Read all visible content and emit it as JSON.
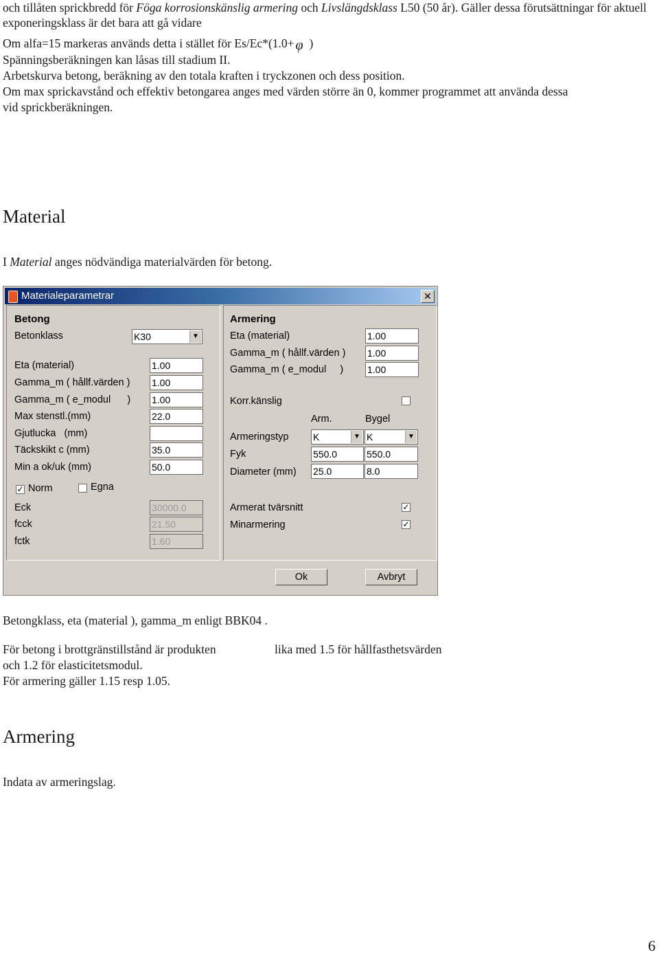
{
  "intro": {
    "line1_a": "och tillåten sprickbredd för ",
    "line1_italic1": "Föga korrosionskänslig armering",
    "line1_b": " och ",
    "line1_italic2": "Livslängdsklass",
    "line1_c": " L50 (50 år). Gäller dessa förutsättningar för aktuell",
    "line2": "exponeringsklass är det bara att gå vidare",
    "line3_a": "Om alfa=15 markeras används detta i stället för Es/Ec*(1.0+",
    "line3_phi": "φ",
    "line3_b": ")",
    "line4": "Spänningsberäkningen kan låsas till stadium II.",
    "line5": "Arbetskurva betong, beräkning av den totala kraften i tryckzonen och dess position.",
    "line6": "Om max sprickavstånd och effektiv betongarea anges med värden större än 0, kommer programmet att använda dessa",
    "line7": "vid sprickberäkningen."
  },
  "material_section": {
    "heading": "Material",
    "desc_a": "I ",
    "desc_italic": "Material",
    "desc_b": " anges nödvändiga materialvärden för betong."
  },
  "dialog": {
    "title": "Materialeparametrar",
    "close_symbol": "✕",
    "betong": {
      "group_label": "Betong",
      "betonklass_label": "Betonklass",
      "betonklass_value": "K30",
      "fields": [
        {
          "label": "Eta (material)",
          "value": "1.00"
        },
        {
          "label": "Gamma_m ( hållf.värden )",
          "value": "1.00"
        },
        {
          "label": "Gamma_m ( e_modul      )",
          "value": "1.00"
        },
        {
          "label": "Max stenstl.(mm)",
          "value": "22.0"
        },
        {
          "label": "Gjutlucka   (mm)",
          "value": ""
        },
        {
          "label": "Täckskikt c (mm)",
          "value": "35.0"
        },
        {
          "label": "Min a ok/uk (mm)",
          "value": "50.0"
        }
      ],
      "norm_label": "Norm",
      "norm_checked": true,
      "egna_label": "Egna",
      "egna_checked": false,
      "computed": [
        {
          "label": "Eck",
          "value": "30000.0"
        },
        {
          "label": "fcck",
          "value": "21.50"
        },
        {
          "label": "fctk",
          "value": "1.60"
        }
      ]
    },
    "armering": {
      "group_label": "Armering",
      "fields": [
        {
          "label": "Eta (material)",
          "value": "1.00"
        },
        {
          "label": "Gamma_m ( hållf.värden )",
          "value": "1.00"
        },
        {
          "label": "Gamma_m ( e_modul     )",
          "value": "1.00"
        }
      ],
      "korr_label": "Korr.känslig",
      "korr_checked": false,
      "col_arm": "Arm.",
      "col_bygel": "Bygel",
      "armeringstyp_label": "Armeringstyp",
      "armeringstyp_arm": "K",
      "armeringstyp_bygel": "K",
      "fyk_label": "Fyk",
      "fyk_arm": "550.0",
      "fyk_bygel": "550.0",
      "diameter_label": "Diameter (mm)",
      "diameter_arm": "25.0",
      "diameter_bygel": "8.0",
      "armerat_label": "Armerat tvärsnitt",
      "armerat_checked": true,
      "minarmering_label": "Minarmering",
      "minarmering_checked": true
    },
    "ok_label": "Ok",
    "cancel_label": "Avbryt",
    "check_mark": "✓"
  },
  "after_dialog": {
    "line1": "Betongklass, eta (material ), gamma_m enligt BBK04 .",
    "line2_a": "För betong i brottgränstillstånd är produkten",
    "line2_b": "lika med 1.5 för hållfasthetsvärden",
    "line3": "och 1.2 för elasticitetsmodul.",
    "line4": "För armering gäller 1.15 resp 1.05."
  },
  "armering_section": {
    "heading": "Armering",
    "desc": "Indata av armeringslag."
  },
  "page_number": "6"
}
